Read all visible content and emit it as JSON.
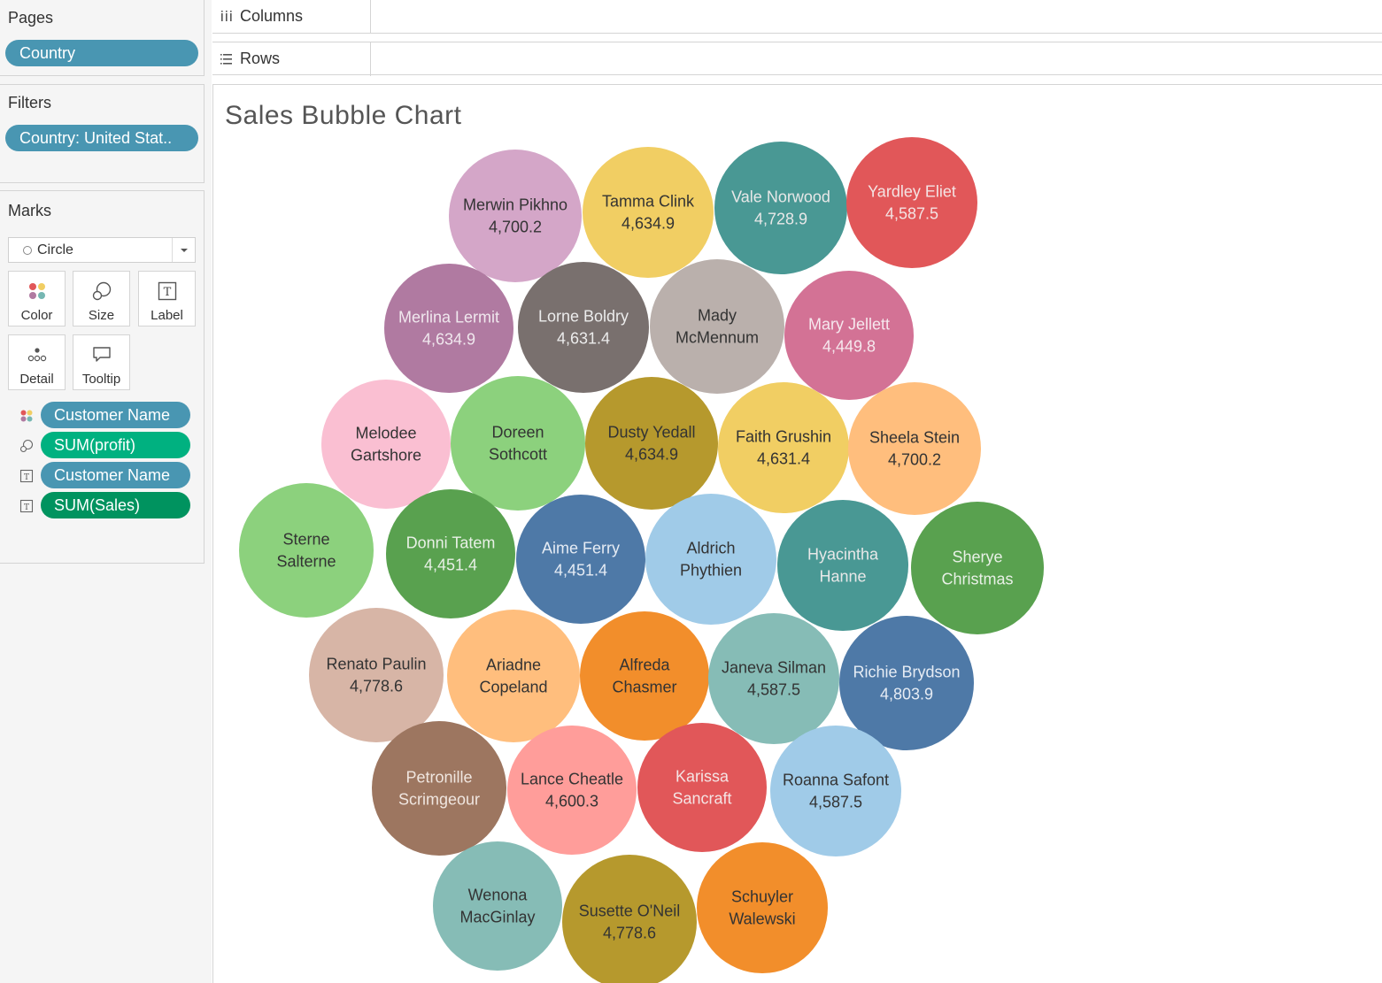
{
  "pages": {
    "title": "Pages",
    "pill": "Country"
  },
  "filters": {
    "title": "Filters",
    "pill": "Country: United Stat.."
  },
  "marks": {
    "title": "Marks",
    "mark_type": "Circle",
    "buttons": {
      "color": "Color",
      "size": "Size",
      "label": "Label",
      "detail": "Detail",
      "tooltip": "Tooltip"
    },
    "shelf": [
      {
        "icon": "color-icon",
        "label": "Customer Name",
        "color": "#4996b2"
      },
      {
        "icon": "size-icon",
        "label": "SUM(profit)",
        "color": "#00b180"
      },
      {
        "icon": "label-icon",
        "label": "Customer Name",
        "color": "#4996b2"
      },
      {
        "icon": "label-icon",
        "label": "SUM(Sales)",
        "color": "#00935f"
      }
    ]
  },
  "columns_shelf": {
    "label": "Columns"
  },
  "rows_shelf": {
    "label": "Rows"
  },
  "chart_data": {
    "type": "bubble",
    "title": "Sales Bubble Chart",
    "label_fields": [
      "Customer Name",
      "SUM(Sales)"
    ],
    "bubbles": [
      {
        "name": "Merwin Pikhno",
        "value": "4,700.2",
        "color": "#d4a6c8",
        "text": "#333333"
      },
      {
        "name": "Tamma Clink",
        "value": "4,634.9",
        "color": "#f1ce63",
        "text": "#333333"
      },
      {
        "name": "Vale Norwood",
        "value": "4,728.9",
        "color": "#499894",
        "text": "#e8e8e8"
      },
      {
        "name": "Yardley Eliet",
        "value": "4,587.5",
        "color": "#e15759",
        "text": "#f4e4e4"
      },
      {
        "name": "Merlina Lermit",
        "value": "4,634.9",
        "color": "#b07aa1",
        "text": "#f0e8ee"
      },
      {
        "name": "Lorne Boldry",
        "value": "4,631.4",
        "color": "#79706e",
        "text": "#ececec"
      },
      {
        "name": "Mady McMennum",
        "value": "",
        "color": "#bab0ac",
        "text": "#333333"
      },
      {
        "name": "Mary Jellett",
        "value": "4,449.8",
        "color": "#d37295",
        "text": "#f6e8ee"
      },
      {
        "name": "Melodee Gartshore",
        "value": "",
        "color": "#fabfd2",
        "text": "#333333"
      },
      {
        "name": "Doreen Sothcott",
        "value": "",
        "color": "#8cd17d",
        "text": "#333333"
      },
      {
        "name": "Dusty Yedall",
        "value": "4,634.9",
        "color": "#b6992d",
        "text": "#333333"
      },
      {
        "name": "Faith Grushin",
        "value": "4,631.4",
        "color": "#f1ce63",
        "text": "#333333"
      },
      {
        "name": "Sheela Stein",
        "value": "4,700.2",
        "color": "#ffbe7d",
        "text": "#333333"
      },
      {
        "name": "Sterne Salterne",
        "value": "",
        "color": "#8cd17d",
        "text": "#333333"
      },
      {
        "name": "Donni Tatem",
        "value": "4,451.4",
        "color": "#59a14f",
        "text": "#e8f0e6"
      },
      {
        "name": "Aime Ferry",
        "value": "4,451.4",
        "color": "#4e79a7",
        "text": "#e6ecf4"
      },
      {
        "name": "Aldrich Phythien",
        "value": "",
        "color": "#a0cbe8",
        "text": "#333333"
      },
      {
        "name": "Hyacintha Hanne",
        "value": "",
        "color": "#499894",
        "text": "#e8e8e8"
      },
      {
        "name": "Sherye Christmas",
        "value": "",
        "color": "#59a14f",
        "text": "#e8f0e6"
      },
      {
        "name": "Renato Paulin",
        "value": "4,778.6",
        "color": "#d7b5a6",
        "text": "#333333"
      },
      {
        "name": "Ariadne Copeland",
        "value": "",
        "color": "#ffbe7d",
        "text": "#333333"
      },
      {
        "name": "Alfreda Chasmer",
        "value": "",
        "color": "#f28e2b",
        "text": "#333333"
      },
      {
        "name": "Janeva Silman",
        "value": "4,587.5",
        "color": "#86bcb6",
        "text": "#333333"
      },
      {
        "name": "Richie Brydson",
        "value": "4,803.9",
        "color": "#4e79a7",
        "text": "#e6ecf4"
      },
      {
        "name": "Petronille Scrimgeour",
        "value": "",
        "color": "#9d7660",
        "text": "#f0e6e0"
      },
      {
        "name": "Lance Cheatle",
        "value": "4,600.3",
        "color": "#ff9d9a",
        "text": "#333333"
      },
      {
        "name": "Karissa Sancraft",
        "value": "",
        "color": "#e15759",
        "text": "#f4e4e4"
      },
      {
        "name": "Roanna Safont",
        "value": "4,587.5",
        "color": "#a0cbe8",
        "text": "#333333"
      },
      {
        "name": "Wenona MacGinlay",
        "value": "",
        "color": "#86bcb6",
        "text": "#333333"
      },
      {
        "name": "Susette O'Neil",
        "value": "4,778.6",
        "color": "#b6992d",
        "text": "#333333"
      },
      {
        "name": "Schuyler Walewski",
        "value": "",
        "color": "#f28e2b",
        "text": "#333333"
      }
    ]
  }
}
